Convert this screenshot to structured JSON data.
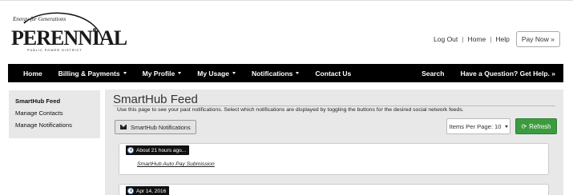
{
  "header": {
    "logo": {
      "tagline": "Energy for Generations",
      "wordmark": "PERENNIAL",
      "subtitle": "PUBLIC POWER DISTRICT"
    },
    "links": {
      "logout": "Log Out",
      "home": "Home",
      "help": "Help",
      "separator": "|"
    },
    "pay_now": "Pay Now »"
  },
  "nav": {
    "items": [
      {
        "label": "Home",
        "dropdown": false
      },
      {
        "label": "Billing & Payments",
        "dropdown": true
      },
      {
        "label": "My Profile",
        "dropdown": true
      },
      {
        "label": "My Usage",
        "dropdown": true
      },
      {
        "label": "Notifications",
        "dropdown": true
      },
      {
        "label": "Contact Us",
        "dropdown": false
      }
    ],
    "search": "Search",
    "help": "Have a Question? Get Help. »"
  },
  "sidebar": {
    "items": [
      {
        "label": "SmartHub Feed",
        "active": true
      },
      {
        "label": "Manage Contacts",
        "active": false
      },
      {
        "label": "Manage Notifications",
        "active": false
      }
    ]
  },
  "main": {
    "title": "SmartHub Feed",
    "description": "Use this page to see your past notifications. Select which notifications are displayed by toggling the buttons for the desired social network feeds.",
    "filter_button": "SmartHub Notifications",
    "items_per_page": "Items Per Page: 10",
    "refresh": "Refresh",
    "feed": [
      {
        "timestamp": "About 21 hours ago...",
        "link": "SmartHub Auto Pay Submission"
      },
      {
        "timestamp": "Apr 14, 2016",
        "link": ""
      }
    ]
  },
  "colors": {
    "nav_bg": "#000000",
    "refresh_bg": "#3d9b3f",
    "panel_bg": "#e8e8e8"
  }
}
